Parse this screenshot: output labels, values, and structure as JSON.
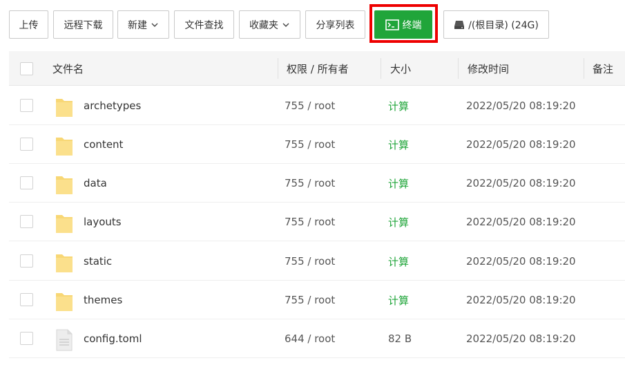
{
  "toolbar": {
    "upload": "上传",
    "remote_download": "远程下载",
    "new": "新建",
    "file_search": "文件查找",
    "favorites": "收藏夹",
    "share_list": "分享列表",
    "terminal": "终端",
    "disk": "/(根目录) (24G)"
  },
  "table": {
    "headers": {
      "name": "文件名",
      "perm": "权限 / 所有者",
      "size": "大小",
      "mtime": "修改时间",
      "note": "备注"
    },
    "rows": [
      {
        "name": "archetypes",
        "perm": "755 / root",
        "size": "计算",
        "mtime": "2022/05/20 08:19:20",
        "type": "folder"
      },
      {
        "name": "content",
        "perm": "755 / root",
        "size": "计算",
        "mtime": "2022/05/20 08:19:20",
        "type": "folder"
      },
      {
        "name": "data",
        "perm": "755 / root",
        "size": "计算",
        "mtime": "2022/05/20 08:19:20",
        "type": "folder"
      },
      {
        "name": "layouts",
        "perm": "755 / root",
        "size": "计算",
        "mtime": "2022/05/20 08:19:20",
        "type": "folder"
      },
      {
        "name": "static",
        "perm": "755 / root",
        "size": "计算",
        "mtime": "2022/05/20 08:19:20",
        "type": "folder"
      },
      {
        "name": "themes",
        "perm": "755 / root",
        "size": "计算",
        "mtime": "2022/05/20 08:19:20",
        "type": "folder"
      },
      {
        "name": "config.toml",
        "perm": "644 / root",
        "size": "82 B",
        "mtime": "2022/05/20 08:19:20",
        "type": "file"
      }
    ]
  },
  "colors": {
    "accent_green": "#20a53a",
    "highlight_red": "#ee0000",
    "folder_yellow": "#f8d775"
  }
}
